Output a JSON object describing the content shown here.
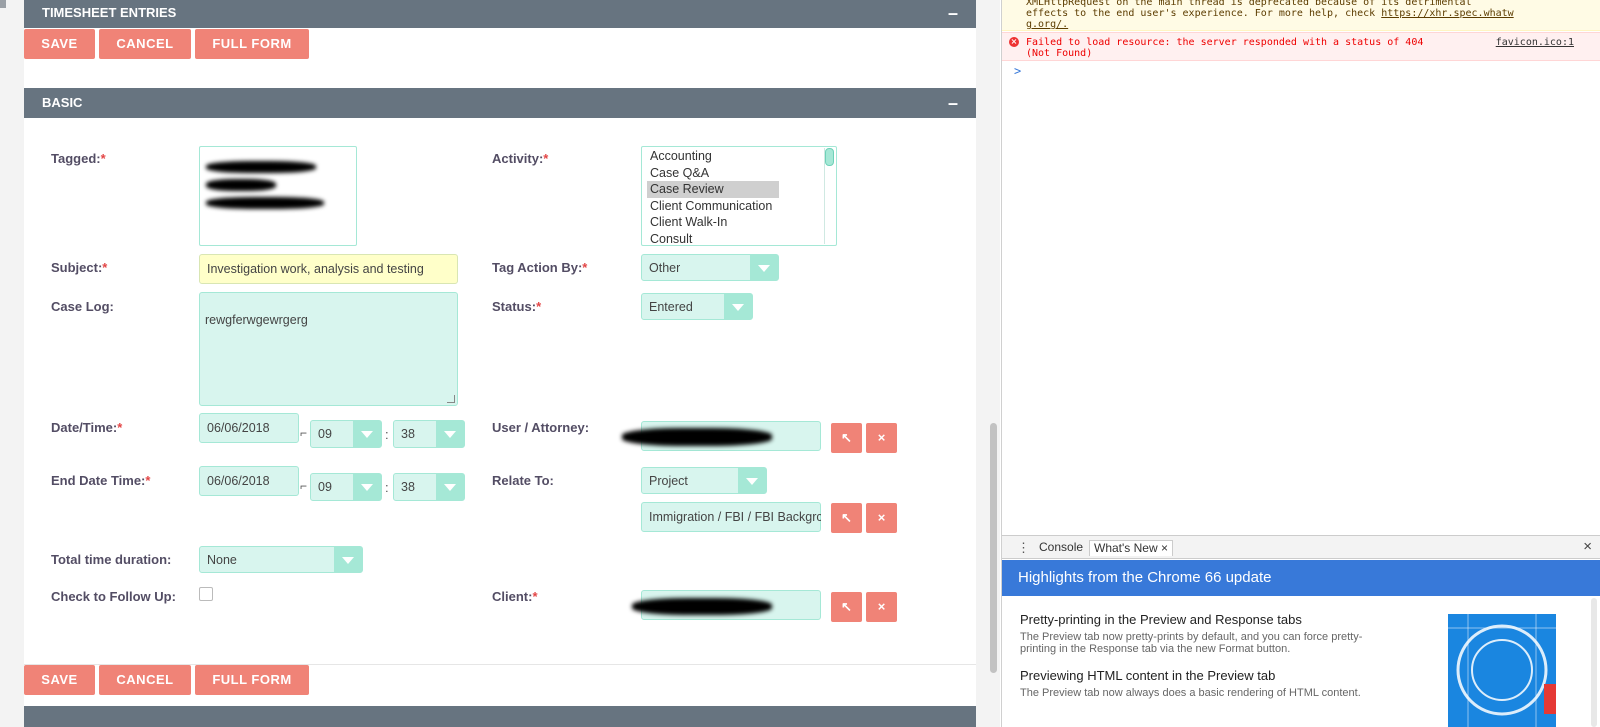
{
  "timesheet_panel": {
    "title": "TIMESHEET ENTRIES",
    "collapse": "–"
  },
  "top_buttons": {
    "save": "SAVE",
    "cancel": "CANCEL",
    "full_form": "FULL FORM"
  },
  "basic_panel": {
    "title": "BASIC",
    "collapse": "–"
  },
  "form": {
    "tagged_label": "Tagged:",
    "activity_label": "Activity:",
    "activity_options": [
      "Accounting",
      "Case Q&A",
      "Case Review",
      "Client Communication",
      "Client Walk-In",
      "Consult"
    ],
    "activity_selected": "Case Review",
    "subject_label": "Subject:",
    "subject_value": "Investigation work, analysis and testing",
    "tag_action_label": "Tag Action By:",
    "tag_action_value": "Other",
    "case_log_label": "Case Log:",
    "case_log_value": "rewgferwgewrgerg",
    "status_label": "Status:",
    "status_value": "Entered",
    "date_time_label": "Date/Time:",
    "date_value": "06/06/2018",
    "hour_value": "09",
    "minute_value": "38",
    "time_sep": ":",
    "user_label": "User / Attorney:",
    "end_label": "End Date Time:",
    "end_date_value": "06/06/2018",
    "end_hour_value": "09",
    "end_minute_value": "38",
    "relate_label": "Relate To:",
    "relate_value": "Project",
    "relate_record_value": "Immigration / FBI / FBI Backgrc",
    "duration_label": "Total time duration:",
    "duration_value": "None",
    "follow_label": "Check to Follow Up:",
    "client_label": "Client:",
    "required_mark": "*",
    "select_icon": "↖",
    "clear_icon": "×",
    "calendar_icon": "📅"
  },
  "bottom_buttons": {
    "save": "SAVE",
    "cancel": "CANCEL",
    "full_form": "FULL FORM"
  },
  "devtools": {
    "warning_line1": "XMLHttpRequest on the main thread is deprecated because of its detrimental",
    "warning_line2_a": "effects to the end user's experience. For more help, check ",
    "warning_link": "https://xhr.spec.whatw",
    "warning_line3": "g.org/.",
    "error_icon": "×",
    "error_msg": "Failed to load resource: the server responded with a status of 404 (Not Found)",
    "error_source": "favicon.ico:1",
    "prompt": ">",
    "drawer_menu": "⋮",
    "tab_console": "Console",
    "tab_whats_new": "What's New ×",
    "close_drawer": "×",
    "whats_new_header": "Highlights from the Chrome 66 update",
    "item1_title": "Pretty-printing in the Preview and Response tabs",
    "item1_desc": "The Preview tab now pretty-prints by default, and you can force pretty-printing in the Response tab via the new Format button.",
    "item2_title": "Previewing HTML content in the Preview tab",
    "item2_desc": "The Preview tab now always does a basic rendering of HTML content."
  },
  "colors": {
    "accent": "#f08377",
    "panel": "#677480",
    "field": "#d8f5ee",
    "devtools_blue": "#3879d9"
  }
}
